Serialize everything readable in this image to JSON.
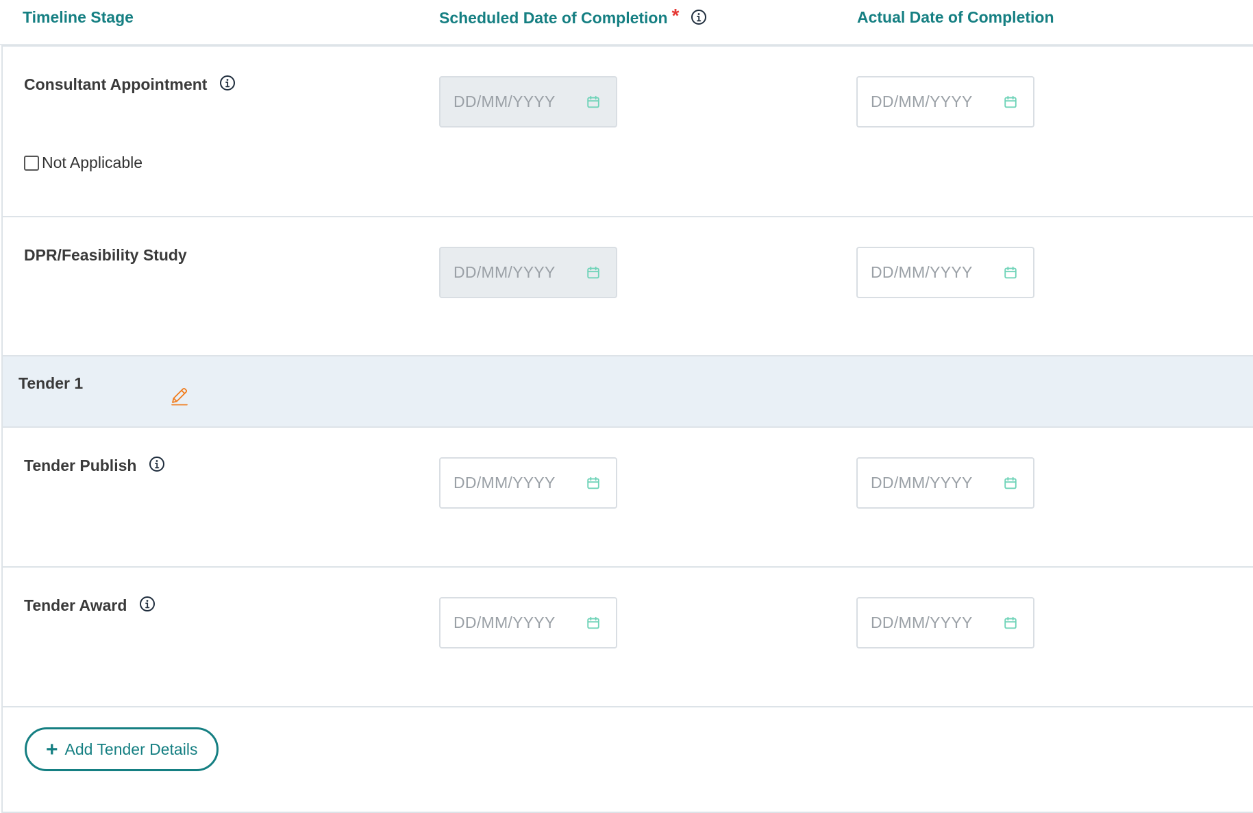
{
  "header": {
    "col_stage": "Timeline Stage",
    "col_scheduled": "Scheduled Date of Completion",
    "col_actual": "Actual Date of Completion",
    "required_mark": "*"
  },
  "rows": [
    {
      "stage": "Consultant Appointment",
      "scheduled_placeholder": "DD/MM/YYYY",
      "actual_placeholder": "DD/MM/YYYY",
      "not_applicable_label": "Not Applicable"
    },
    {
      "stage": "DPR/Feasibility Study",
      "scheduled_placeholder": "DD/MM/YYYY",
      "actual_placeholder": "DD/MM/YYYY"
    }
  ],
  "tender": {
    "title": "Tender 1",
    "rows": [
      {
        "stage": "Tender Publish",
        "scheduled_placeholder": "DD/MM/YYYY",
        "actual_placeholder": "DD/MM/YYYY"
      },
      {
        "stage": "Tender Award",
        "scheduled_placeholder": "DD/MM/YYYY",
        "actual_placeholder": "DD/MM/YYYY"
      }
    ]
  },
  "add_button": {
    "icon": "+",
    "label": "Add Tender Details"
  },
  "icons": {
    "info": "info-icon",
    "calendar": "calendar-icon",
    "edit": "pencil-edit-icon",
    "plus": "plus-icon"
  },
  "colors": {
    "accent": "#157f82",
    "required": "#e53935",
    "edit_icon": "#f07c1d",
    "calendar_icon": "#6fd3b8",
    "tender_band": "#e9f0f6",
    "disabled_field": "#e8ecef"
  }
}
